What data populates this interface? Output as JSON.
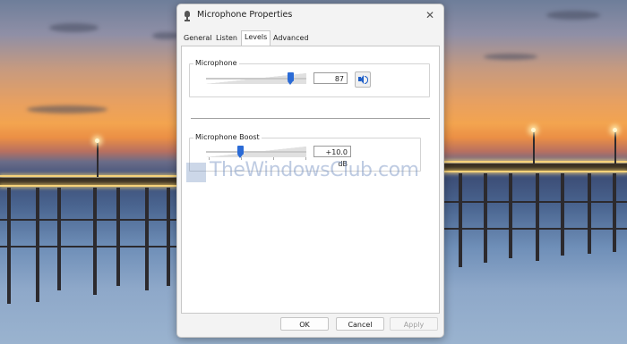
{
  "dialog": {
    "title": "Microphone Properties",
    "close_glyph": "✕"
  },
  "tabs": [
    {
      "label": "General",
      "active": false
    },
    {
      "label": "Listen",
      "active": false
    },
    {
      "label": "Levels",
      "active": true
    },
    {
      "label": "Advanced",
      "active": false
    }
  ],
  "levels": {
    "microphone": {
      "label": "Microphone",
      "value": "87",
      "level_fraction": 0.87,
      "speaker_icon": "speaker-icon"
    },
    "boost": {
      "label": "Microphone Boost",
      "value": "+10.0 dB",
      "level_fraction": 0.33
    }
  },
  "watermark": {
    "text": "TheWindowsClub.com"
  },
  "buttons": {
    "ok": "OK",
    "cancel": "Cancel",
    "apply": "Apply"
  },
  "colors": {
    "accent": "#2b6bd6"
  }
}
